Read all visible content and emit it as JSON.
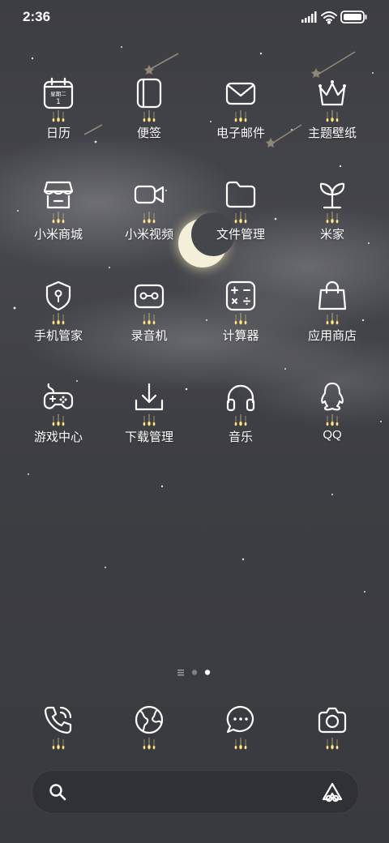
{
  "status_bar": {
    "time": "2:36",
    "icons": [
      "signal-icon",
      "wifi-icon",
      "battery-icon"
    ]
  },
  "apps": [
    {
      "label": "日历",
      "icon": "calendar-icon",
      "date_weekday": "星期二",
      "date_day": "1"
    },
    {
      "label": "便签",
      "icon": "notes-icon"
    },
    {
      "label": "电子邮件",
      "icon": "mail-icon"
    },
    {
      "label": "主题壁纸",
      "icon": "crown-icon"
    },
    {
      "label": "小米商城",
      "icon": "store-icon"
    },
    {
      "label": "小米视频",
      "icon": "video-icon"
    },
    {
      "label": "文件管理",
      "icon": "folder-icon"
    },
    {
      "label": "米家",
      "icon": "sprout-icon"
    },
    {
      "label": "手机管家",
      "icon": "shield-icon"
    },
    {
      "label": "录音机",
      "icon": "recorder-icon"
    },
    {
      "label": "计算器",
      "icon": "calculator-icon"
    },
    {
      "label": "应用商店",
      "icon": "shopping-bag-icon"
    },
    {
      "label": "游戏中心",
      "icon": "gamepad-icon"
    },
    {
      "label": "下载管理",
      "icon": "download-icon"
    },
    {
      "label": "音乐",
      "icon": "headphones-icon"
    },
    {
      "label": "QQ",
      "icon": "qq-penguin-icon"
    }
  ],
  "page_indicator": {
    "pages": 3,
    "current": 3
  },
  "dock": [
    {
      "icon": "phone-icon"
    },
    {
      "icon": "browser-globe-icon"
    },
    {
      "icon": "messages-icon"
    },
    {
      "icon": "camera-icon"
    }
  ],
  "search": {
    "placeholder": "",
    "icon": "search-icon",
    "assistant_icon": "assistant-logo-icon"
  },
  "colors": {
    "icon_stroke": "#ffffff",
    "glow": "#ffd970",
    "wallpaper": "#3a3b40"
  }
}
